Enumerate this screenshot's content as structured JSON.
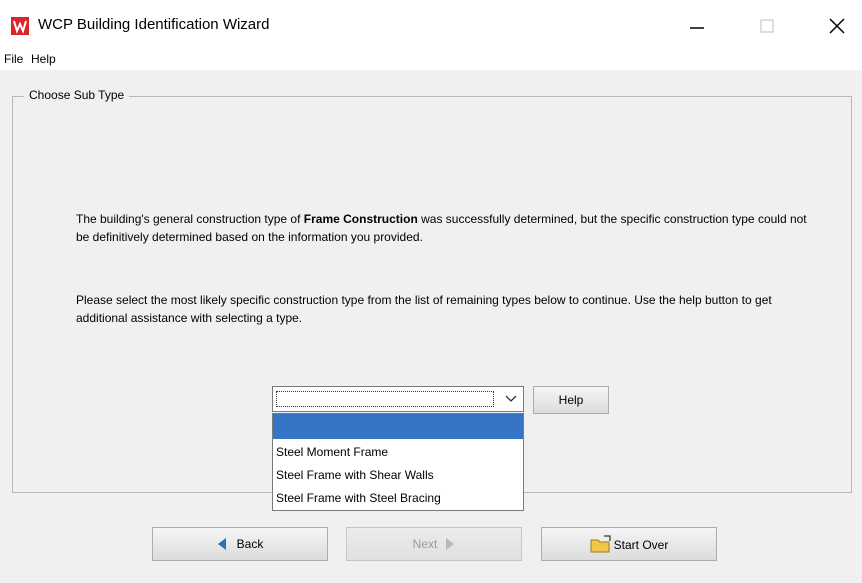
{
  "window": {
    "title": "WCP Building Identification Wizard",
    "icon": "app-logo-icon",
    "controls": [
      "minimize-icon",
      "maximize-icon",
      "close-icon"
    ]
  },
  "menu": {
    "file": "File",
    "help": "Help"
  },
  "panel": {
    "legend": "Choose Sub Type",
    "para1_part1": "The building's general construction type of ",
    "para1_bold": "Frame Construction",
    "para1_part2": " was successfully determined, but the specific construction type could not be definitively determined based on the information you provided.",
    "para2": "Please select the most likely specific construction type from the list of remaining types below to continue. Use the help button to get additional assistance with selecting a type."
  },
  "combo": {
    "selected": "",
    "options": [
      "",
      "Steel Moment Frame",
      "Steel Frame with Shear Walls",
      "Steel Frame with Steel Bracing"
    ]
  },
  "buttons": {
    "help": "Help",
    "back": "Back",
    "next": "Next",
    "start_over": "Start Over"
  },
  "colors": {
    "selection": "#3574c6",
    "icon_red": "#d9262b",
    "folder_yellow": "#f3c745",
    "arrow_blue": "#2f6db5"
  }
}
